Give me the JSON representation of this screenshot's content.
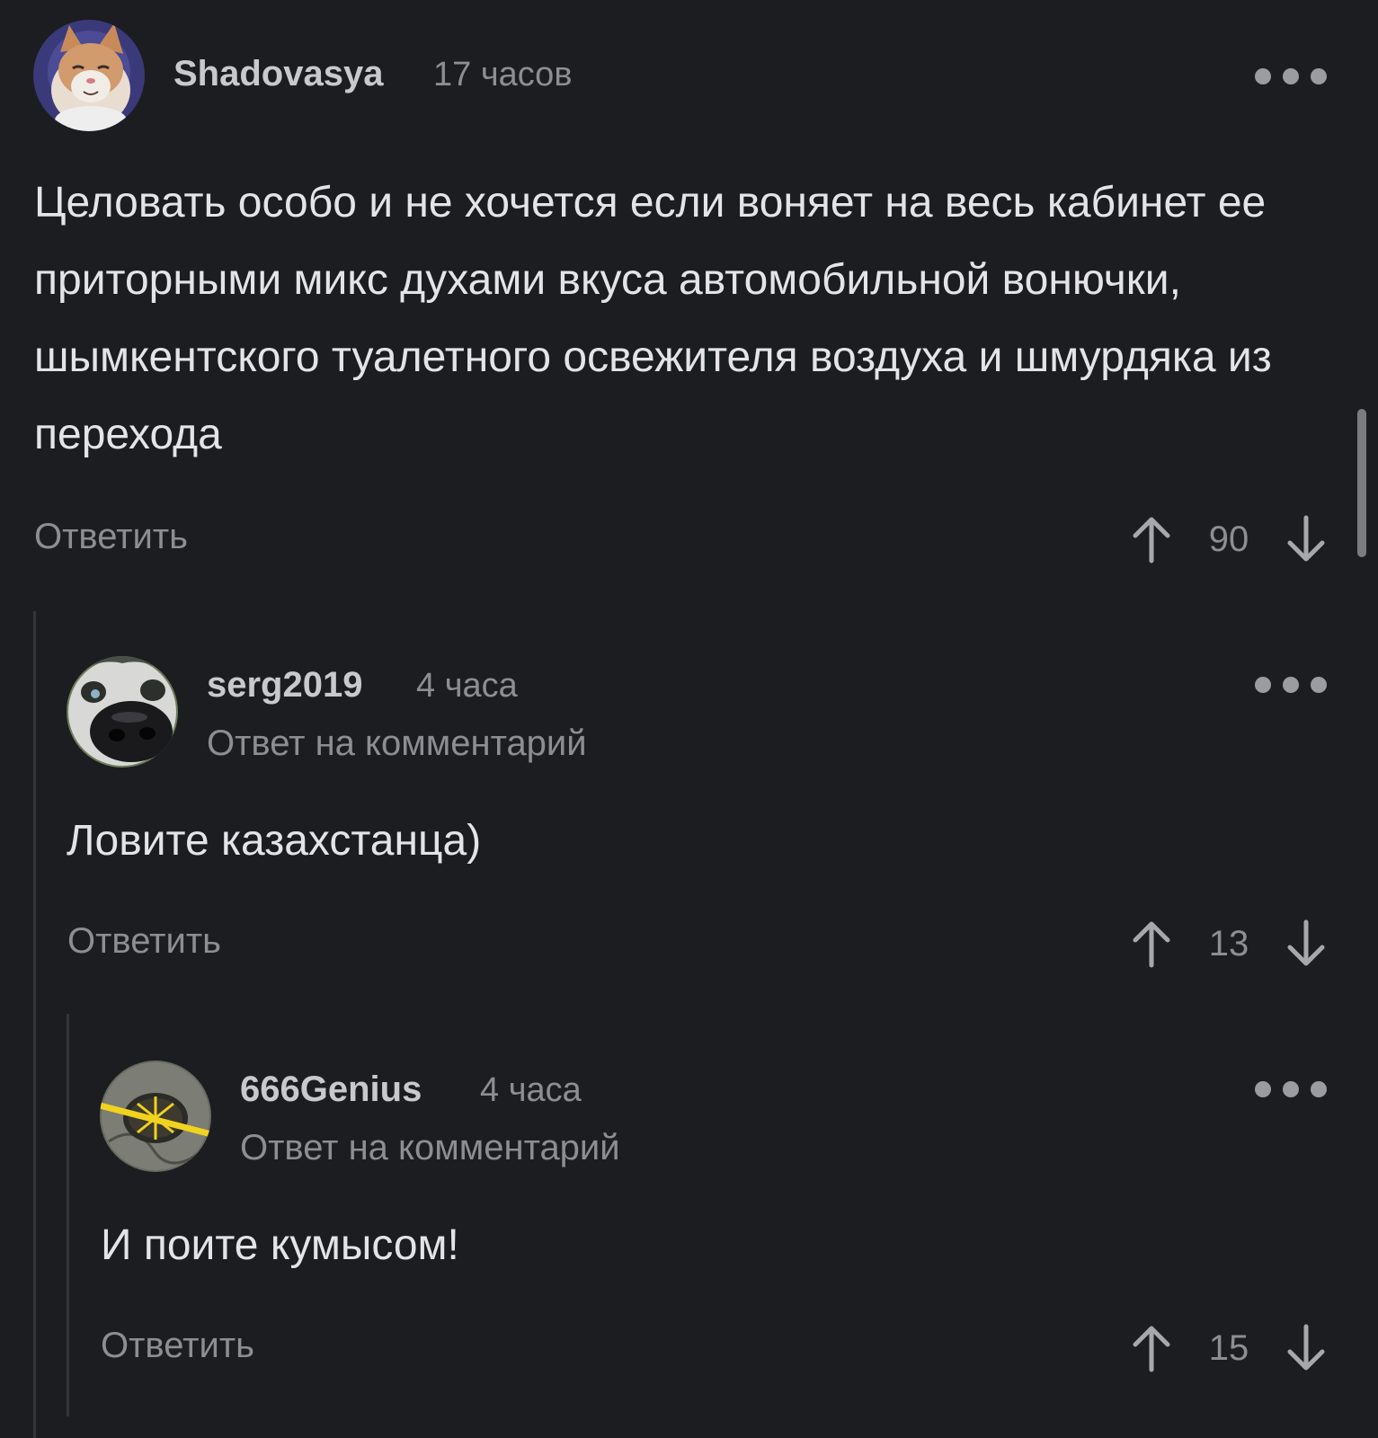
{
  "comments": [
    {
      "username": "Shadovasya",
      "time": "17 часов",
      "text": "Целовать особо и не хочется если воняет на весь кабинет ее приторными микс духами вкуса автомобильной вонючки, шымкентского туалетного освежителя воздуха и шмурдяка из перехода",
      "reply_label": "Ответить",
      "score": "90",
      "avatar": "cat-avatar"
    },
    {
      "username": "serg2019",
      "time": "4 часа",
      "reply_note": "Ответ на комментарий",
      "text": "Ловите казахстанца)",
      "reply_label": "Ответить",
      "score": "13",
      "avatar": "dog-nose-avatar"
    },
    {
      "username": "666Genius",
      "time": "4 часа",
      "reply_note": "Ответ на комментарий",
      "text": "И поите кумысом!",
      "reply_label": "Ответить",
      "score": "15",
      "avatar": "manhole-avatar"
    }
  ],
  "icons": {
    "more": "more-dots-icon",
    "upvote": "arrow-up-icon",
    "downvote": "arrow-down-icon"
  },
  "colors": {
    "background": "#1c1d21",
    "text": "#e4e4e6",
    "muted": "#8d8e93",
    "thread_line": "#34353a"
  }
}
